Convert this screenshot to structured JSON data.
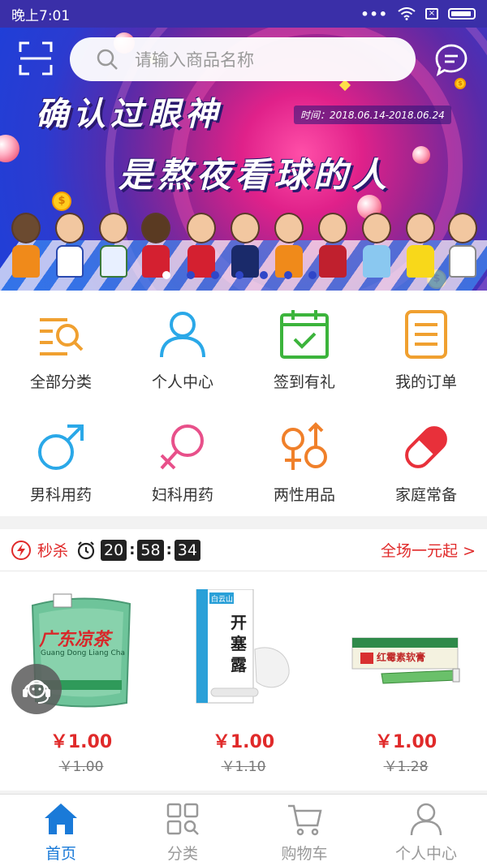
{
  "status_bar": {
    "time": "晚上7:01",
    "dots": "•••"
  },
  "banner": {
    "headline_1": "确认过眼神",
    "headline_2": "是熬夜看球的人",
    "date_range": "时间：2018.06.14-2018.06.24",
    "coin_symbol": "$"
  },
  "search": {
    "placeholder": "请输入商品名称"
  },
  "categories": [
    {
      "label": "全部分类",
      "icon": "list-search-icon",
      "color": "#f0a030"
    },
    {
      "label": "个人中心",
      "icon": "person-icon",
      "color": "#2aa8e8"
    },
    {
      "label": "签到有礼",
      "icon": "calendar-check-icon",
      "color": "#3cb43c"
    },
    {
      "label": "我的订单",
      "icon": "order-list-icon",
      "color": "#f0a030"
    },
    {
      "label": "男科用药",
      "icon": "male-symbol-icon",
      "color": "#2aa8e8"
    },
    {
      "label": "妇科用药",
      "icon": "female-symbol-icon",
      "color": "#e8508a"
    },
    {
      "label": "两性用品",
      "icon": "gender-pair-icon",
      "color": "#f0802a"
    },
    {
      "label": "家庭常备",
      "icon": "pill-icon",
      "color": "#e8303a"
    }
  ],
  "flash_sale": {
    "title": "秒杀",
    "countdown": {
      "hours": "20",
      "minutes": "58",
      "seconds": "34"
    },
    "more_label": "全场一元起 >",
    "products": [
      {
        "name_on_pack": "广东凉茶",
        "pack_sub": "Guang Dong Liang Cha",
        "price": "￥1.00",
        "original_price": "￥1.00"
      },
      {
        "name_on_pack": "开塞露",
        "pack_sub": "白云山",
        "price": "￥1.00",
        "original_price": "￥1.10"
      },
      {
        "name_on_pack": "红霉素软膏",
        "pack_sub": "",
        "price": "￥1.00",
        "original_price": "￥1.28"
      }
    ]
  },
  "tabbar": [
    {
      "label": "首页",
      "icon": "home-icon",
      "active": true
    },
    {
      "label": "分类",
      "icon": "category-grid-icon",
      "active": false
    },
    {
      "label": "购物车",
      "icon": "cart-icon",
      "active": false
    },
    {
      "label": "个人中心",
      "icon": "profile-icon",
      "active": false
    }
  ],
  "colors": {
    "accent": "#1a7ad8",
    "price_red": "#e02a2a",
    "status_bg": "#3a2fa8"
  }
}
